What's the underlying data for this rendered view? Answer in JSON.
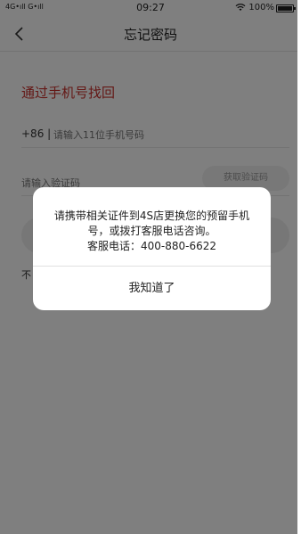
{
  "status_bar": {
    "carrier": "4G•ıll  G•ıll",
    "time": "09:27",
    "battery": "100%"
  },
  "nav": {
    "title": "忘记密码"
  },
  "form": {
    "section_title": "通过手机号找回",
    "country_code": "+86 |",
    "phone_placeholder": "请输入11位手机号码",
    "code_placeholder": "请输入验证码",
    "get_code_label": "获取验证码",
    "hint_prefix": "不"
  },
  "dialog": {
    "message_line1": "请携带相关证件到4S店更换您的预留手机号，或拨打客服电话咨询。",
    "message_line2": "客服电话：400-880-6622",
    "confirm_label": "我知道了"
  },
  "colors": {
    "accent": "#c9302c",
    "overlay": "rgba(0,0,0,0.5)"
  },
  "icons": {
    "back": "chevron-left-icon",
    "wifi": "wifi-icon",
    "battery": "battery-icon"
  }
}
